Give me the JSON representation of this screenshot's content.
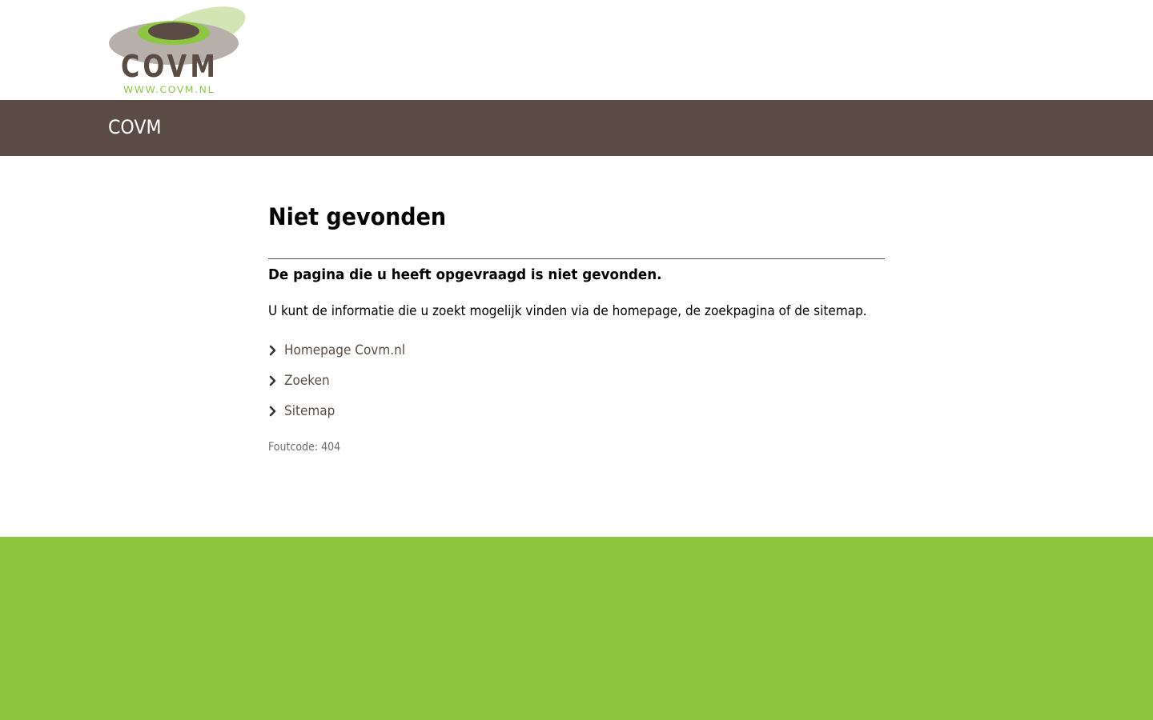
{
  "logo": {
    "wordmark": "COVM",
    "url_text": "WWW.COVM.NL"
  },
  "banner": {
    "title": "COVM"
  },
  "main": {
    "title": "Niet gevonden",
    "lead": "De pagina die u heeft opgevraagd is niet gevonden.",
    "info": "U kunt de informatie die u zoekt mogelijk vinden via de homepage, de zoekpagina of de sitemap.",
    "links": [
      {
        "label": "Homepage Covm.nl"
      },
      {
        "label": "Zoeken"
      },
      {
        "label": "Sitemap"
      }
    ],
    "error_code": "Foutcode: 404"
  },
  "colors": {
    "banner": "#5a4c44",
    "footer": "#8dc63f",
    "link": "#5a4c44"
  }
}
